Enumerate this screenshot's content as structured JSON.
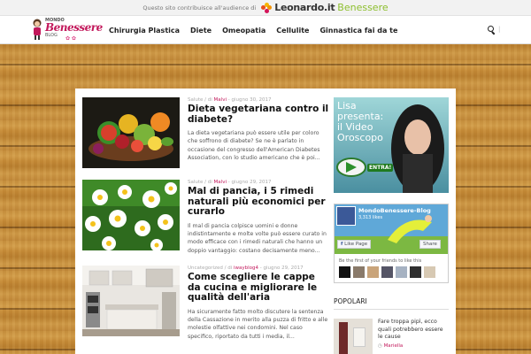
{
  "topbar": {
    "notice": "Questo sito contribuisce all'audience di",
    "brand_main": "Leonardo.it",
    "brand_sub": "Benessere"
  },
  "logo": {
    "line1": "MONDO",
    "line2": "Benessere",
    "line3": "BLOG"
  },
  "nav": {
    "items": [
      {
        "label": "Chirurgia Plastica"
      },
      {
        "label": "Diete"
      },
      {
        "label": "Omeopatia"
      },
      {
        "label": "Cellulite"
      },
      {
        "label": "Ginnastica fai da te"
      }
    ]
  },
  "posts": [
    {
      "category": "Salute",
      "author": "Malvi",
      "date": "giugno 30, 2017",
      "title": "Dieta vegetariana contro il diabete?",
      "excerpt": "La dieta vegetariana può essere utile per coloro che soffrono di diabete? Se ne è parlato in occasione del congresso dell'American Diabetes Association, con lo studio americano che è poi..."
    },
    {
      "category": "Salute",
      "author": "Malvi",
      "date": "giugno 29, 2017",
      "title": "Mal di pancia, i 5 rimedi naturali più economici per curarlo",
      "excerpt": "Il mal di pancia colpisce uomini e donne indistintamente e molte volte può essere curato in modo efficace con i rimedi naturali che hanno un doppio vantaggio: costano decisamente meno..."
    },
    {
      "category": "Uncategorized",
      "author": "iwayblog4",
      "date": "giugno 29, 2017",
      "title": "Come scegliere le cappe da cucina e migliorare le qualità dell'aria",
      "excerpt": "Ha sicuramente fatto molto discutere la sentenza della Cassazione in merito alla puzza di fritto e alle molestie olfattive nei condomini. Nel caso specifico, riportato da tutti i media, il..."
    }
  ],
  "ad": {
    "line1": "Lisa",
    "line2": "presenta:",
    "line3": "il Video",
    "line4": "Oroscopo",
    "button": "ENTRA!"
  },
  "facebook": {
    "page_name": "MondoBenessere-Blog",
    "likes_count": "3,313 likes",
    "like_button": "Like Page",
    "share_button": "Share",
    "friends_note": "Be the first of your friends to like this"
  },
  "popular": {
    "heading": "POPOLARI",
    "items": [
      {
        "title": "Fare troppa pipì, ecco quali potrebbero essere le cause",
        "author": "Mariella"
      }
    ]
  },
  "colors": {
    "accent": "#c2185b",
    "leonardo_green": "#8dbf2e",
    "facebook_blue": "#3b5998",
    "wood": "#c8913e"
  }
}
